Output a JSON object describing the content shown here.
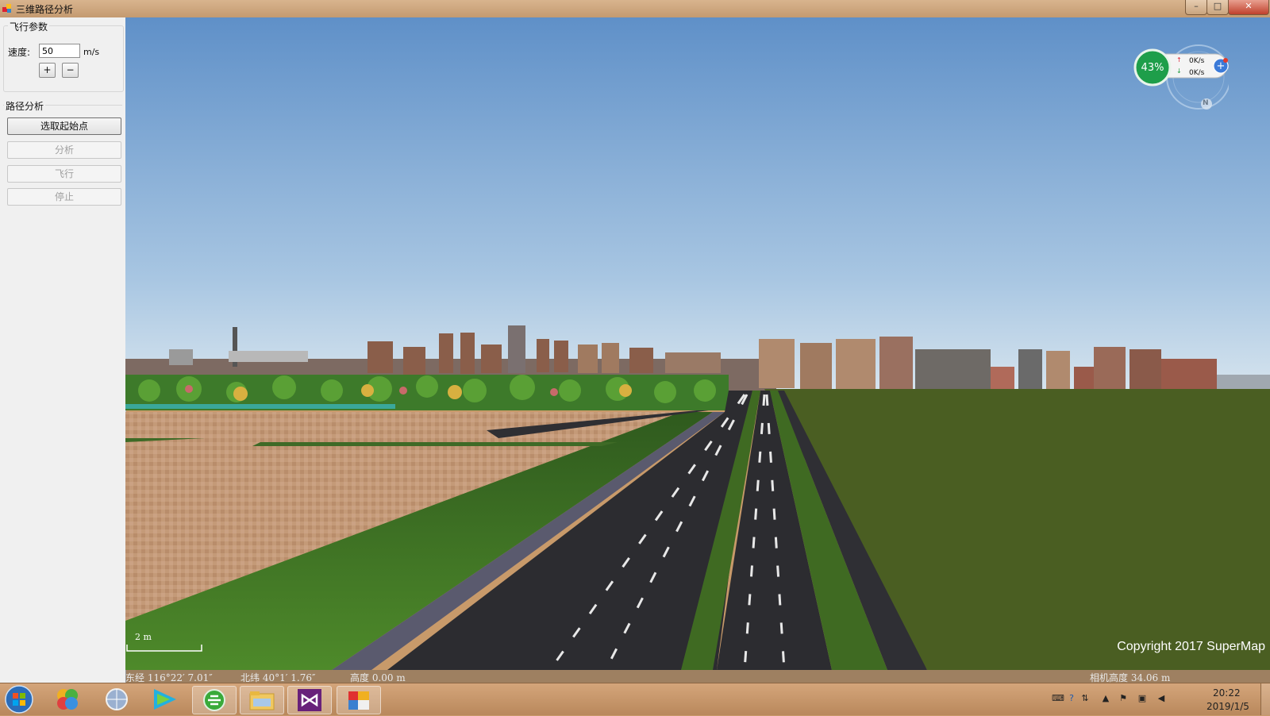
{
  "window": {
    "title": "三维路径分析",
    "controls": {
      "minimize": "–",
      "maximize": "□",
      "close": "✕"
    }
  },
  "left_panel": {
    "flight_group": {
      "title": "飞行参数",
      "speed_label": "速度:",
      "speed_value": "50",
      "speed_unit": "m/s",
      "increase_label": "+",
      "decrease_label": "−"
    },
    "path_group": {
      "title": "路径分析",
      "buttons": [
        {
          "label": "选取起始点",
          "enabled": true
        },
        {
          "label": "分析",
          "enabled": false
        },
        {
          "label": "飞行",
          "enabled": false
        },
        {
          "label": "停止",
          "enabled": false
        }
      ]
    }
  },
  "viewport": {
    "scale_label": "2 m",
    "longitude": "东经 116°22′ 7.01″",
    "latitude": "北纬 40°1′ 1.76″",
    "altitude": "高度 0.00 m",
    "camera_altitude": "相机高度 34.06 m",
    "copyright": "Copyright 2017 SuperMap"
  },
  "net_widget": {
    "percent": "43%",
    "upload": "0K/s",
    "download": "0K/s",
    "compass": "N"
  },
  "taskbar": {
    "items": [
      "start-button",
      "taskbar-app-pinwheel",
      "taskbar-app-globe",
      "taskbar-app-player",
      "taskbar-app-ie",
      "taskbar-app-explorer",
      "taskbar-app-visualstudio",
      "taskbar-app-supermap"
    ],
    "clock_time": "20:22",
    "clock_date": "2019/1/5"
  }
}
